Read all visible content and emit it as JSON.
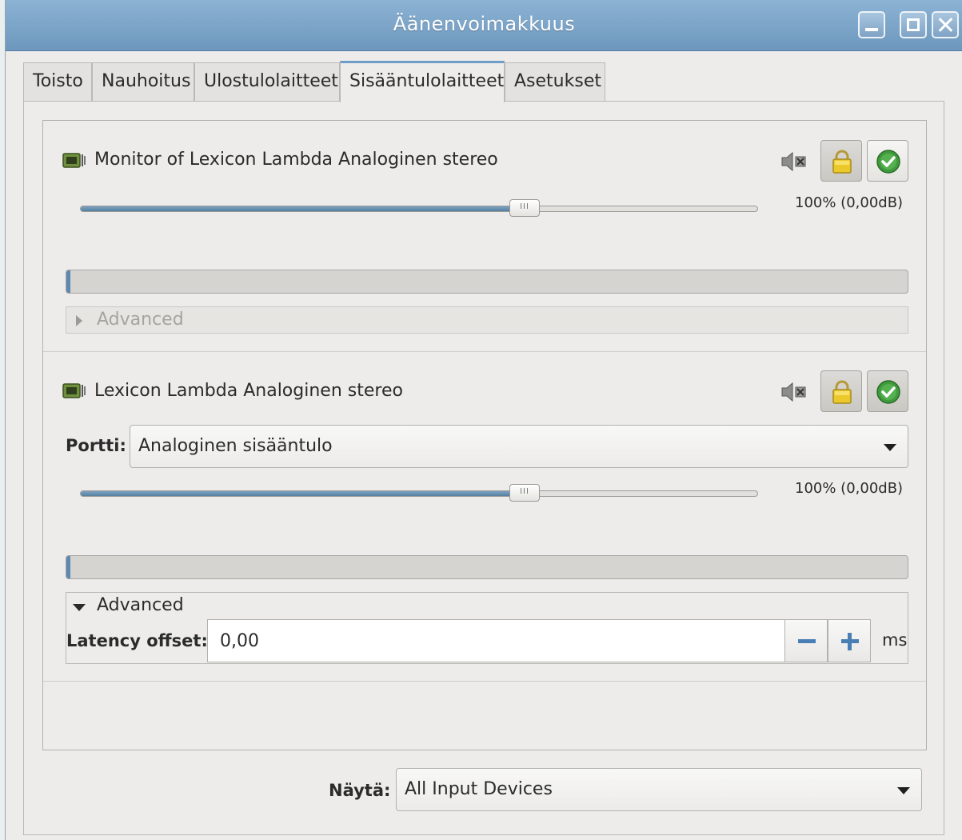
{
  "window": {
    "title": "Äänenvoimakkuus"
  },
  "tabs": [
    {
      "label": "Toisto",
      "active": false
    },
    {
      "label": "Nauhoitus",
      "active": false
    },
    {
      "label": "Ulostulolaitteet",
      "active": false
    },
    {
      "label": "Sisääntulolaitteet",
      "active": true
    },
    {
      "label": "Asetukset",
      "active": false
    }
  ],
  "devices": [
    {
      "name": "Monitor of Lexicon Lambda Analoginen stereo",
      "icon": "sound-card-icon",
      "volume_fraction": 1.0,
      "volume_label": "100% (0,00dB)",
      "lock_active": false,
      "default_active": false,
      "advanced_label": "Advanced",
      "advanced_expanded": false
    },
    {
      "name": "Lexicon Lambda Analoginen stereo",
      "icon": "sound-card-icon",
      "port_label": "Portti:",
      "port_value": "Analoginen sisääntulo",
      "volume_fraction": 1.0,
      "volume_label": "100% (0,00dB)",
      "lock_active": true,
      "default_active": true,
      "advanced_label": "Advanced",
      "advanced_expanded": true,
      "latency_label": "Latency offset:",
      "latency_value": "0,00",
      "latency_unit": "ms"
    }
  ],
  "footer": {
    "show_label": "Näytä:",
    "show_value": "All Input Devices"
  },
  "colors": {
    "titlebar": "#7ba3c8",
    "accent": "#5e88ad",
    "spin_blue": "#4a7fb5",
    "default_green": "#3f9a3c",
    "lock_yellow": "#e6c227"
  }
}
